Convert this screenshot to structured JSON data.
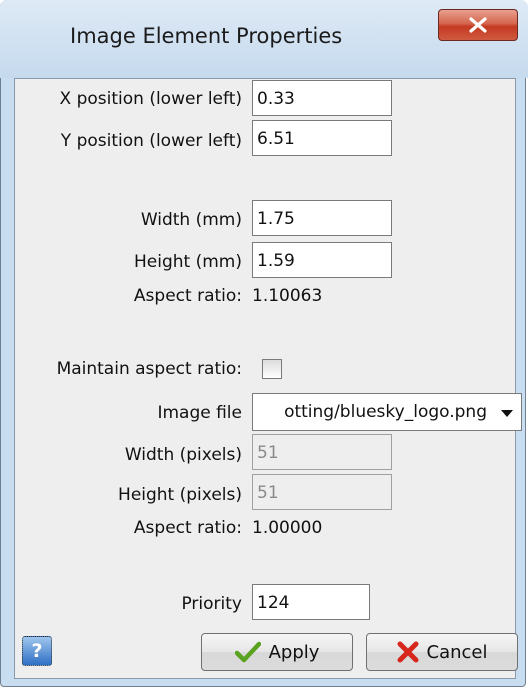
{
  "window": {
    "title": "Image Element Properties",
    "close_icon": "close-x-icon"
  },
  "form": {
    "x_position": {
      "label": "X position (lower left)",
      "value": "0.33"
    },
    "y_position": {
      "label": "Y position (lower left)",
      "value": "6.51"
    },
    "width_mm": {
      "label": "Width (mm)",
      "value": "1.75"
    },
    "height_mm": {
      "label": "Height (mm)",
      "value": "1.59"
    },
    "aspect_ratio_mm": {
      "label": "Aspect ratio:",
      "value": "1.10063"
    },
    "maintain_aspect": {
      "label": "Maintain aspect ratio:",
      "checked": false
    },
    "image_file": {
      "label": "Image file",
      "value": "otting/bluesky_logo.png"
    },
    "width_px": {
      "label": "Width (pixels)",
      "value": "51"
    },
    "height_px": {
      "label": "Height (pixels)",
      "value": "51"
    },
    "aspect_ratio_px": {
      "label": "Aspect ratio:",
      "value": "1.00000"
    },
    "priority": {
      "label": "Priority",
      "value": "124"
    }
  },
  "buttons": {
    "help": {
      "glyph": "?",
      "icon": "help-icon"
    },
    "apply": {
      "label": "Apply",
      "icon": "checkmark-icon"
    },
    "cancel": {
      "label": "Cancel",
      "icon": "red-x-icon"
    }
  },
  "colors": {
    "window_frame": "#c9ddf0",
    "close_button": "#c43a22",
    "apply_check": "#5aa321",
    "cancel_x": "#d7261b"
  }
}
